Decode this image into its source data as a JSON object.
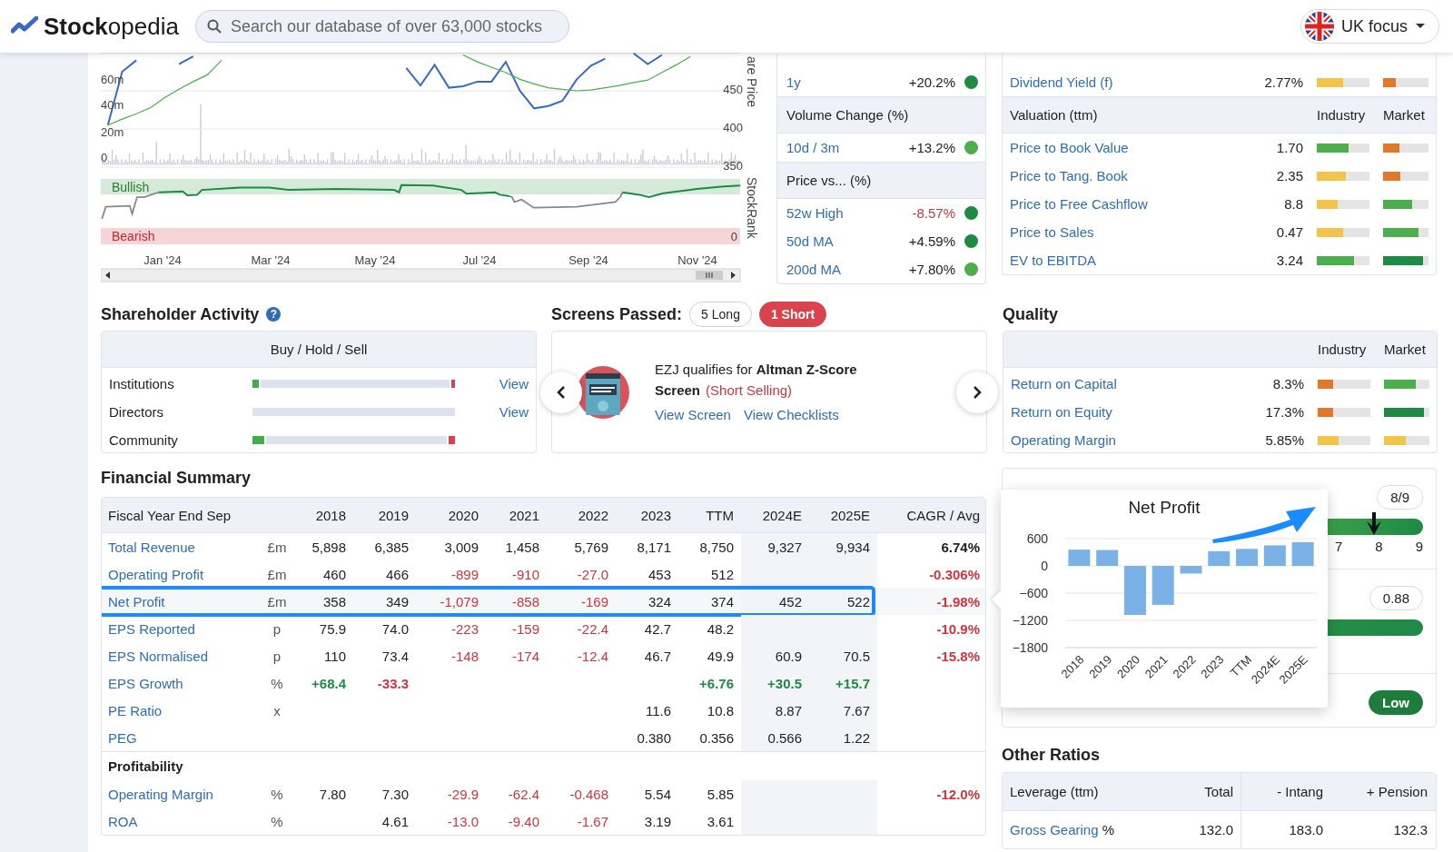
{
  "header": {
    "logo": "**Stock**opedia",
    "search": {
      "placeholder": "Search our database of over 63,000 stocks"
    },
    "region_button": "UK focus"
  },
  "price_chart": {
    "volume_ticks": [
      "60m",
      "40m",
      "20m",
      "0"
    ],
    "price_axis": "are Price",
    "rank_axis": "StockRank",
    "bands": [
      "Bullish",
      "Bearish"
    ],
    "rank_zero": "0",
    "months": [
      "Jan '24",
      "Mar '24",
      "May '24",
      "Jul '24",
      "Sep '24",
      "Nov '24"
    ],
    "chart_data": {
      "type": "line",
      "grid": true,
      "ylim": [
        350,
        500
      ],
      "yticks": [
        {
          "value": 450,
          "label": "450"
        },
        {
          "value": 400,
          "label": "400"
        },
        {
          "value": 350,
          "label": "350"
        }
      ],
      "series": [
        {
          "color": "#3a6bc4",
          "values": [
            405,
            475,
            490,
            null,
            null,
            485,
            495,
            null,
            null,
            null,
            null,
            null,
            null,
            null,
            null,
            null,
            null,
            null,
            null,
            null,
            null,
            480,
            457,
            484,
            454,
            456,
            462,
            462,
            488,
            450,
            427,
            430,
            437,
            465,
            483,
            492,
            null,
            499,
            485,
            497,
            null,
            null,
            null,
            null,
            null
          ]
        },
        {
          "color": "#4cae4c",
          "values": [
            405,
            413,
            420,
            428,
            441,
            452,
            462,
            471,
            490,
            null,
            null,
            null,
            null,
            null,
            null,
            null,
            null,
            null,
            null,
            null,
            null,
            null,
            null,
            null,
            null,
            497,
            488,
            481,
            474,
            465,
            459,
            454,
            452,
            450,
            451,
            454,
            457,
            461,
            464,
            474,
            484,
            495,
            null,
            null,
            null
          ]
        }
      ]
    }
  },
  "momentum": {
    "sections": [
      {
        "rows": [
          {
            "label": "1y",
            "value": "+20.2%",
            "negative": false,
            "color": "#1e8a44"
          }
        ]
      },
      {
        "title": "Volume Change (%)",
        "rows": [
          {
            "label": "10d / 3m",
            "value": "+13.2%",
            "negative": false,
            "color": "#4cae4c"
          }
        ]
      },
      {
        "title": "Price vs... (%)",
        "rows": [
          {
            "label": "52w High",
            "value": "-8.57%",
            "negative": true,
            "color": "#1e8a44"
          },
          {
            "label": "50d MA",
            "value": "+4.59%",
            "negative": false,
            "color": "#1e8a44"
          },
          {
            "label": "200d MA",
            "value": "+7.80%",
            "negative": false,
            "color": "#4cae4c"
          }
        ]
      }
    ]
  },
  "ratios": {
    "sections": [
      {
        "rows": [
          {
            "label": "Dividend Yield (f)",
            "value": "2.77%",
            "industry": {
              "level": 0.5,
              "color": "#f2c44c"
            },
            "market": {
              "level": 0.28,
              "color": "#e07a2a"
            }
          }
        ]
      },
      {
        "title": "Valuation (ttm)",
        "columns": [
          "Industry",
          "Market"
        ],
        "rows": [
          {
            "label": "Price to Book Value",
            "value": "1.70",
            "industry": {
              "level": 0.6,
              "color": "#4cae4c"
            },
            "market": {
              "level": 0.35,
              "color": "#e07a2a"
            }
          },
          {
            "label": "Price to Tang. Book",
            "value": "2.35",
            "industry": {
              "level": 0.56,
              "color": "#f2c44c"
            },
            "market": {
              "level": 0.37,
              "color": "#e07a2a"
            }
          },
          {
            "label": "Price to Free Cashflow",
            "value": "8.8",
            "industry": {
              "level": 0.4,
              "color": "#f2c44c"
            },
            "market": {
              "level": 0.63,
              "color": "#4cae4c"
            }
          },
          {
            "label": "Price to Sales",
            "value": "0.47",
            "industry": {
              "level": 0.5,
              "color": "#f2c44c"
            },
            "market": {
              "level": 0.78,
              "color": "#4cae4c"
            }
          },
          {
            "label": "EV to EBITDA",
            "value": "3.24",
            "industry": {
              "level": 0.7,
              "color": "#4cae4c"
            },
            "market": {
              "level": 0.88,
              "color": "#1e8a44"
            }
          }
        ]
      }
    ]
  },
  "shareholder": {
    "title": "Shareholder Activity",
    "help_icon": "?",
    "header": "Buy / Hold / Sell",
    "rows": [
      {
        "label": "Institutions",
        "buy": {
          "level": 0.03
        },
        "sell": {
          "level": 0.02
        },
        "link": "View"
      },
      {
        "label": "Directors",
        "link": "View"
      },
      {
        "label": "Community",
        "buy": {
          "level": 0.06
        },
        "sell": {
          "level": 0.03
        }
      }
    ]
  },
  "screens": {
    "title": "Screens Passed:",
    "pills": [
      {
        "label": "5 Long",
        "selected": false
      },
      {
        "label": "1 Short",
        "selected": true
      }
    ],
    "card": {
      "text": "EZJ qualifies for **Altman Z-Score Screen**",
      "tag": "(Short Selling)",
      "links": [
        "View Screen",
        "View Checklists"
      ]
    }
  },
  "quality": {
    "title": "Quality",
    "columns": [
      "Industry",
      "Market"
    ],
    "rows": [
      {
        "label": "Return on Capital",
        "value": "8.3%",
        "industry": {
          "level": 0.3,
          "color": "#e07a2a"
        },
        "market": {
          "level": 0.7,
          "color": "#4cae4c"
        }
      },
      {
        "label": "Return on Equity",
        "value": "17.3%",
        "industry": {
          "level": 0.3,
          "color": "#e07a2a"
        },
        "market": {
          "level": 0.87,
          "color": "#1e8a44"
        }
      },
      {
        "label": "Operating Margin",
        "value": "5.85%",
        "industry": {
          "level": 0.4,
          "color": "#f2c44c"
        },
        "market": {
          "level": 0.48,
          "color": "#f2c44c"
        }
      }
    ]
  },
  "financial": {
    "title": "Financial Summary",
    "header_label": "Fiscal Year End Sep",
    "summary_label": "CAGR / Avg",
    "columns": [
      {
        "label": "2018",
        "estimate": false
      },
      {
        "label": "2019",
        "estimate": false
      },
      {
        "label": "2020",
        "estimate": false
      },
      {
        "label": "2021",
        "estimate": false
      },
      {
        "label": "2022",
        "estimate": false
      },
      {
        "label": "2023",
        "estimate": false
      },
      {
        "label": "TTM",
        "estimate": false
      },
      {
        "label": "2024E",
        "estimate": true
      },
      {
        "label": "2025E",
        "estimate": true
      }
    ],
    "rows": [
      {
        "kind": "data",
        "label": "Total Revenue",
        "unit": "£m",
        "highlighted": false,
        "values": [
          "5,898",
          "6,385",
          "3,009",
          "1,458",
          "5,769",
          "8,171",
          "8,750",
          "9,327",
          "9,934"
        ],
        "summary": {
          "text": "6.74%",
          "color": "#222222",
          "bold": true
        }
      },
      {
        "kind": "data",
        "label": "Operating Profit",
        "unit": "£m",
        "highlighted": false,
        "values": [
          "460",
          "466",
          {
            "text": "-899",
            "color": "#d0343f",
            "bold": false
          },
          {
            "text": "-910",
            "color": "#d0343f",
            "bold": false
          },
          {
            "text": "-27.0",
            "color": "#d0343f",
            "bold": false
          },
          "453",
          "512",
          {
            "kind": "empty"
          },
          {
            "kind": "empty"
          }
        ],
        "summary": {
          "text": "-0.306%",
          "color": "#d0343f",
          "bold": true
        }
      },
      {
        "kind": "data",
        "label": "Net Profit",
        "unit": "£m",
        "highlighted": true,
        "values": [
          "358",
          "349",
          {
            "text": "-1,079",
            "color": "#d0343f",
            "bold": false
          },
          {
            "text": "-858",
            "color": "#d0343f",
            "bold": false
          },
          {
            "text": "-169",
            "color": "#d0343f",
            "bold": false
          },
          "324",
          "374",
          "452",
          "522"
        ],
        "summary": {
          "text": "-1.98%",
          "color": "#d0343f",
          "bold": true
        }
      },
      {
        "kind": "data",
        "label": "EPS Reported",
        "unit": "p",
        "highlighted": false,
        "values": [
          "75.9",
          "74.0",
          {
            "text": "-223",
            "color": "#d0343f",
            "bold": false
          },
          {
            "text": "-159",
            "color": "#d0343f",
            "bold": false
          },
          {
            "text": "-22.4",
            "color": "#d0343f",
            "bold": false
          },
          "42.7",
          "48.2",
          {
            "kind": "empty"
          },
          {
            "kind": "empty"
          }
        ],
        "summary": {
          "text": "-10.9%",
          "color": "#d0343f",
          "bold": true
        }
      },
      {
        "kind": "data",
        "label": "EPS Normalised",
        "unit": "p",
        "highlighted": false,
        "values": [
          "110",
          "73.4",
          {
            "text": "-148",
            "color": "#d0343f",
            "bold": false
          },
          {
            "text": "-174",
            "color": "#d0343f",
            "bold": false
          },
          {
            "text": "-12.4",
            "color": "#d0343f",
            "bold": false
          },
          "46.7",
          "49.9",
          "60.9",
          "70.5"
        ],
        "summary": {
          "text": "-15.8%",
          "color": "#d0343f",
          "bold": true
        }
      },
      {
        "kind": "data",
        "label": "EPS Growth",
        "unit": "%",
        "highlighted": false,
        "values": [
          {
            "text": "+68.4",
            "color": "#1e8a44",
            "bold": true
          },
          {
            "text": "-33.3",
            "color": "#d0343f",
            "bold": true
          },
          {
            "kind": "empty"
          },
          {
            "kind": "empty"
          },
          {
            "kind": "empty"
          },
          {
            "kind": "empty"
          },
          {
            "text": "+6.76",
            "color": "#1e8a44",
            "bold": true
          },
          {
            "text": "+30.5",
            "color": "#1e8a44",
            "bold": true
          },
          {
            "text": "+15.7",
            "color": "#1e8a44",
            "bold": true
          }
        ]
      },
      {
        "kind": "data",
        "label": "PE Ratio",
        "unit": "x",
        "highlighted": false,
        "values": [
          {
            "kind": "empty"
          },
          {
            "kind": "empty"
          },
          {
            "kind": "empty"
          },
          {
            "kind": "empty"
          },
          {
            "kind": "empty"
          },
          "11.6",
          "10.8",
          "8.87",
          "7.67"
        ]
      },
      {
        "kind": "data",
        "label": "PEG",
        "highlighted": false,
        "values": [
          {
            "kind": "empty"
          },
          {
            "kind": "empty"
          },
          {
            "kind": "empty"
          },
          {
            "kind": "empty"
          },
          {
            "kind": "empty"
          },
          "0.380",
          "0.356",
          "0.566",
          "1.22"
        ]
      },
      {
        "kind": "section",
        "label": "Profitability"
      },
      {
        "kind": "data",
        "label": "Operating Margin",
        "unit": "%",
        "highlighted": false,
        "values": [
          "7.80",
          "7.30",
          {
            "text": "-29.9",
            "color": "#d0343f",
            "bold": false
          },
          {
            "text": "-62.4",
            "color": "#d0343f",
            "bold": false
          },
          {
            "text": "-0.468",
            "color": "#d0343f",
            "bold": false
          },
          "5.54",
          "5.85",
          {
            "kind": "empty"
          },
          {
            "kind": "empty"
          }
        ],
        "summary": {
          "text": "-12.0%",
          "color": "#d0343f",
          "bold": true
        }
      },
      {
        "kind": "data",
        "label": "ROA",
        "unit": "%",
        "highlighted": false,
        "values": [
          {
            "kind": "empty"
          },
          "4.61",
          {
            "text": "-13.0",
            "color": "#d0343f",
            "bold": false
          },
          {
            "text": "-9.40",
            "color": "#d0343f",
            "bold": false
          },
          {
            "text": "-1.67",
            "color": "#d0343f",
            "bold": false
          },
          "3.19",
          "3.61",
          {
            "kind": "empty"
          },
          {
            "kind": "empty"
          }
        ]
      }
    ]
  },
  "risk": {
    "rows": [
      {
        "kind": "scale",
        "badge": "8/9",
        "level": 0.88,
        "ticks": [
          "7",
          "8",
          "9"
        ]
      },
      {
        "kind": "bar",
        "badge": "0.88"
      },
      {
        "kind": "label",
        "badge": "Low"
      }
    ]
  },
  "popup": {
    "chart_data": {
      "type": "bar",
      "title": "Net Profit",
      "grid": true,
      "categories": [
        "2018",
        "2019",
        "2020",
        "2021",
        "2022",
        "2023",
        "TTM",
        "2024E",
        "2025E"
      ],
      "values": [
        358,
        349,
        -1079,
        -858,
        -169,
        324,
        374,
        452,
        522
      ],
      "ylim": [
        -1800,
        600
      ],
      "yticks": [
        {
          "value": 600,
          "label": "600"
        },
        {
          "value": 0,
          "label": "0"
        },
        {
          "value": -600,
          "label": "−600"
        },
        {
          "value": -1200,
          "label": "−1200"
        },
        {
          "value": -1800,
          "label": "−1800"
        }
      ]
    }
  },
  "other_ratios": {
    "title": "Other Ratios",
    "columns": [
      "Leverage (ttm)",
      "Total",
      "- Intang",
      "+ Pension"
    ],
    "rows": [
      {
        "label": "Gross Gearing",
        "unit": "%",
        "values": [
          "132.0",
          "183.0",
          "132.3"
        ]
      }
    ]
  }
}
